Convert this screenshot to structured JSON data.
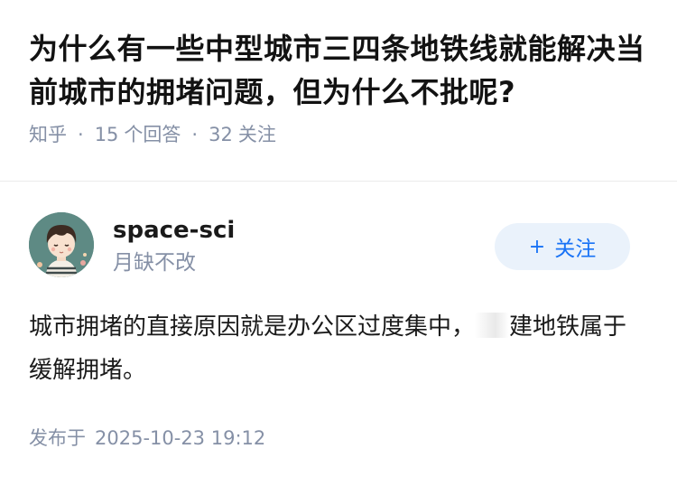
{
  "question": {
    "title": "为什么有一些中型城市三四条地铁线就能解决当前城市的拥堵问题，但为什么不批呢?",
    "source": "知乎",
    "answer_count": "15",
    "answer_label": "个回答",
    "follower_count": "32",
    "follower_label": "关注"
  },
  "author": {
    "name": "space-sci",
    "bio": "月缺不改",
    "avatar_icon": "avatar-cartoon-boy"
  },
  "follow_button": {
    "label": "关注",
    "icon": "plus-icon"
  },
  "answer": {
    "text_before": "城市拥堵的直接原因就是办公区过度集中，",
    "text_after": "建地铁属于缓解拥堵。"
  },
  "publish": {
    "label": "发布于",
    "datetime": "2025-10-23 19:12"
  },
  "colors": {
    "meta_gray": "#8590a6",
    "accent_blue": "#1772f6",
    "follow_bg": "#eaf2fb"
  }
}
